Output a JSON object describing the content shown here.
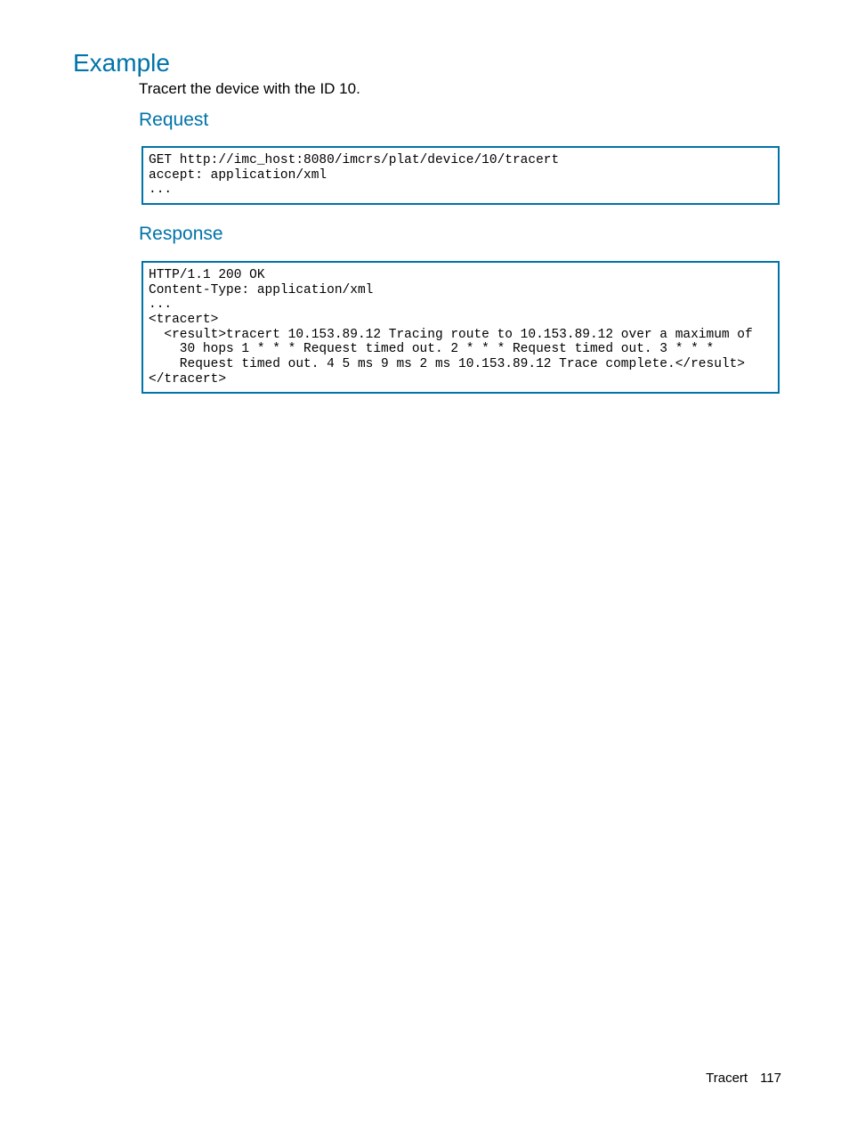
{
  "headings": {
    "example": "Example",
    "request": "Request",
    "response": "Response"
  },
  "body": {
    "example_desc": "Tracert the device with the ID 10."
  },
  "code": {
    "request": "GET http://imc_host:8080/imcrs/plat/device/10/tracert\naccept: application/xml\n...",
    "response": "HTTP/1.1 200 OK\nContent-Type: application/xml\n...\n<tracert>\n  <result>tracert 10.153.89.12 Tracing route to 10.153.89.12 over a maximum of\n    30 hops 1 * * * Request timed out. 2 * * * Request timed out. 3 * * *\n    Request timed out. 4 5 ms 9 ms 2 ms 10.153.89.12 Trace complete.</result>\n</tracert>"
  },
  "footer": {
    "section": "Tracert",
    "page": "117"
  }
}
